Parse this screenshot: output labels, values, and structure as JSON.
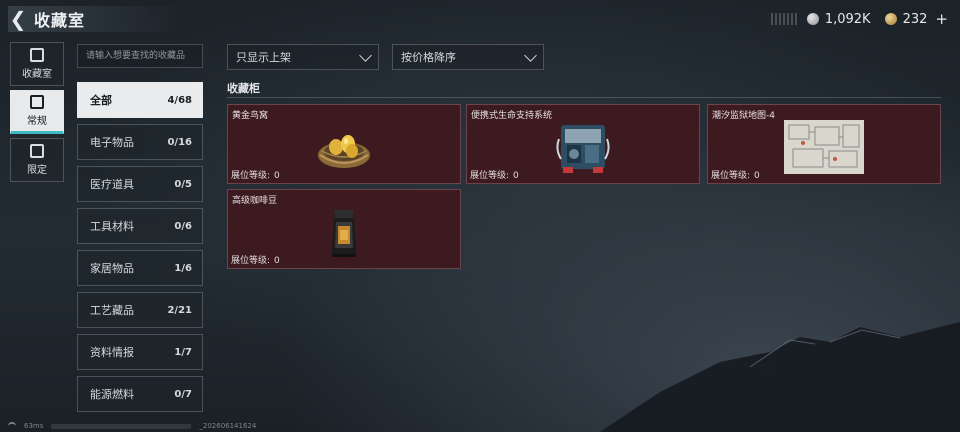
{
  "header": {
    "title": "收藏室",
    "back_icon": "back-arrow-icon"
  },
  "currency": {
    "silver": "1,092K",
    "gold": "232",
    "plus": "+"
  },
  "sidebar": [
    {
      "label": "收藏室",
      "icon": "collection-room-icon",
      "active": false
    },
    {
      "label": "常规",
      "icon": "image-icon",
      "active": true
    },
    {
      "label": "限定",
      "icon": "limited-icon",
      "active": false
    }
  ],
  "search": {
    "placeholder": "请输入想要查找的收藏品"
  },
  "categories": [
    {
      "name": "全部",
      "count": "4/68"
    },
    {
      "name": "电子物品",
      "count": "0/16"
    },
    {
      "name": "医疗道具",
      "count": "0/5"
    },
    {
      "name": "工具材料",
      "count": "0/6"
    },
    {
      "name": "家居物品",
      "count": "1/6"
    },
    {
      "name": "工艺藏品",
      "count": "2/21"
    },
    {
      "name": "资料情报",
      "count": "1/7"
    },
    {
      "name": "能源燃料",
      "count": "0/7"
    }
  ],
  "filters": {
    "display": "只显示上架",
    "sort": "按价格降序"
  },
  "section_title": "收藏柜",
  "level_label": "展位等级:",
  "items": [
    {
      "name": "黄金鸟窝",
      "level": "0",
      "icon": "golden-nest-icon"
    },
    {
      "name": "便携式生命支持系统",
      "level": "0",
      "icon": "life-support-icon"
    },
    {
      "name": "潮汐监狱地图-4",
      "level": "0",
      "icon": "map-icon"
    },
    {
      "name": "高级咖啡豆",
      "level": "0",
      "icon": "coffee-bag-icon"
    }
  ],
  "status": {
    "ping": "63ms",
    "build": "_202606141624"
  },
  "colors": {
    "card_bg": "#3d1a1f",
    "accent": "#3fb9c2"
  }
}
